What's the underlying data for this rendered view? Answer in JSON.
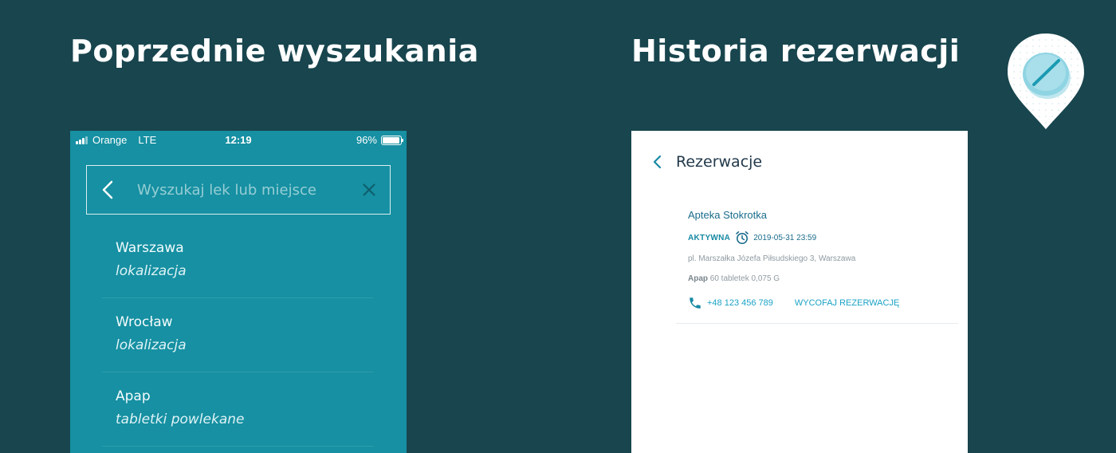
{
  "headings": {
    "left": "Poprzednie wyszukania",
    "right": "Historia rezerwacji"
  },
  "statusbar": {
    "carrier": "Orange",
    "network": "LTE",
    "time": "12:19",
    "battery": "96%",
    "battery_level": 0.96
  },
  "search": {
    "placeholder": "Wyszukaj lek lub miejsce",
    "value": ""
  },
  "results": [
    {
      "title": "Warszawa",
      "subtitle": "lokalizacja"
    },
    {
      "title": "Wrocław",
      "subtitle": "lokalizacja"
    },
    {
      "title": "Apap",
      "subtitle": "tabletki powlekane"
    }
  ],
  "reservations": {
    "title": "Rezerwacje",
    "item": {
      "pharmacy": "Apteka Stokrotka",
      "status": "AKTYWNA",
      "datetime": "2019-05-31 23:59",
      "address": "pl. Marszałka Józefa Piłsudskiego 3, Warszawa",
      "product_name": "Apap",
      "product_detail": "60 tabletek 0,075 G",
      "phone": "+48 123 456 789",
      "cancel_label": "WYCOFAJ REZERWACJĘ"
    }
  },
  "colors": {
    "background": "#18454e",
    "search_phone": "#1690a2",
    "accent": "#1ba2c6",
    "text_dark": "#22394a"
  },
  "icons": {
    "logo": "pill-pin-icon",
    "back": "chevron-left-icon",
    "clear": "close-icon",
    "clock": "alarm-clock-icon",
    "phone": "phone-icon"
  }
}
